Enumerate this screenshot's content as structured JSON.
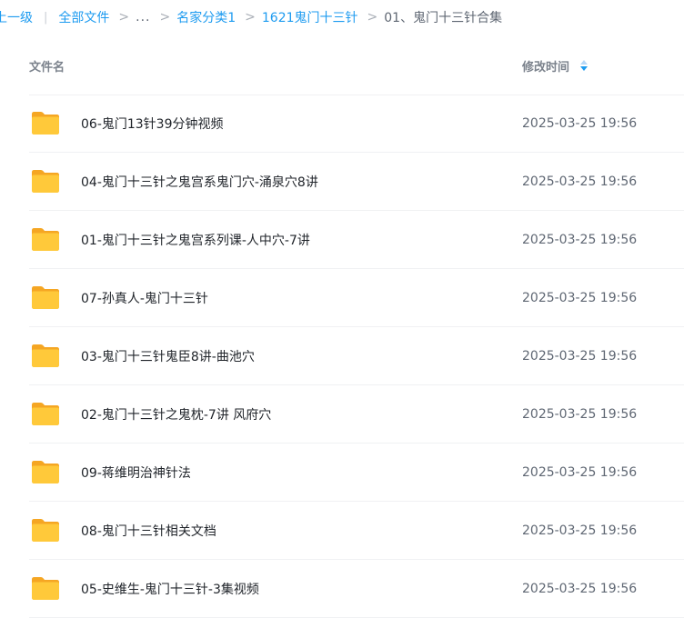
{
  "breadcrumb": {
    "back": "上一级",
    "separator_bar": "|",
    "separator_chevron": ">",
    "all_files": "全部文件",
    "ellipsis": "...",
    "level1": "名家分类1",
    "level2": "1621鬼门十三针",
    "current": "01、鬼门十三针合集"
  },
  "table": {
    "header_name": "文件名",
    "header_time": "修改时间",
    "rows": [
      {
        "name": "06-鬼门13针39分钟视频",
        "time": "2025-03-25 19:56"
      },
      {
        "name": "04-鬼门十三针之鬼宫系鬼门穴-涌泉穴8讲",
        "time": "2025-03-25 19:56"
      },
      {
        "name": "01-鬼门十三针之鬼宫系列课-人中穴-7讲",
        "time": "2025-03-25 19:56"
      },
      {
        "name": "07-孙真人-鬼门十三针",
        "time": "2025-03-25 19:56"
      },
      {
        "name": "03-鬼门十三针鬼臣8讲-曲池穴",
        "time": "2025-03-25 19:56"
      },
      {
        "name": "02-鬼门十三针之鬼枕-7讲 风府穴",
        "time": "2025-03-25 19:56"
      },
      {
        "name": "09-蒋维明治神针法",
        "time": "2025-03-25 19:56"
      },
      {
        "name": "08-鬼门十三针相关文档",
        "time": "2025-03-25 19:56"
      },
      {
        "name": "05-史维生-鬼门十三针-3集视频",
        "time": "2025-03-25 19:56"
      }
    ]
  },
  "colors": {
    "accent": "#1d9bf0",
    "folder_body": "#ffc93a",
    "folder_back": "#f5a623"
  },
  "icons": {
    "folder": "folder-icon",
    "sort": "sort-icon"
  }
}
